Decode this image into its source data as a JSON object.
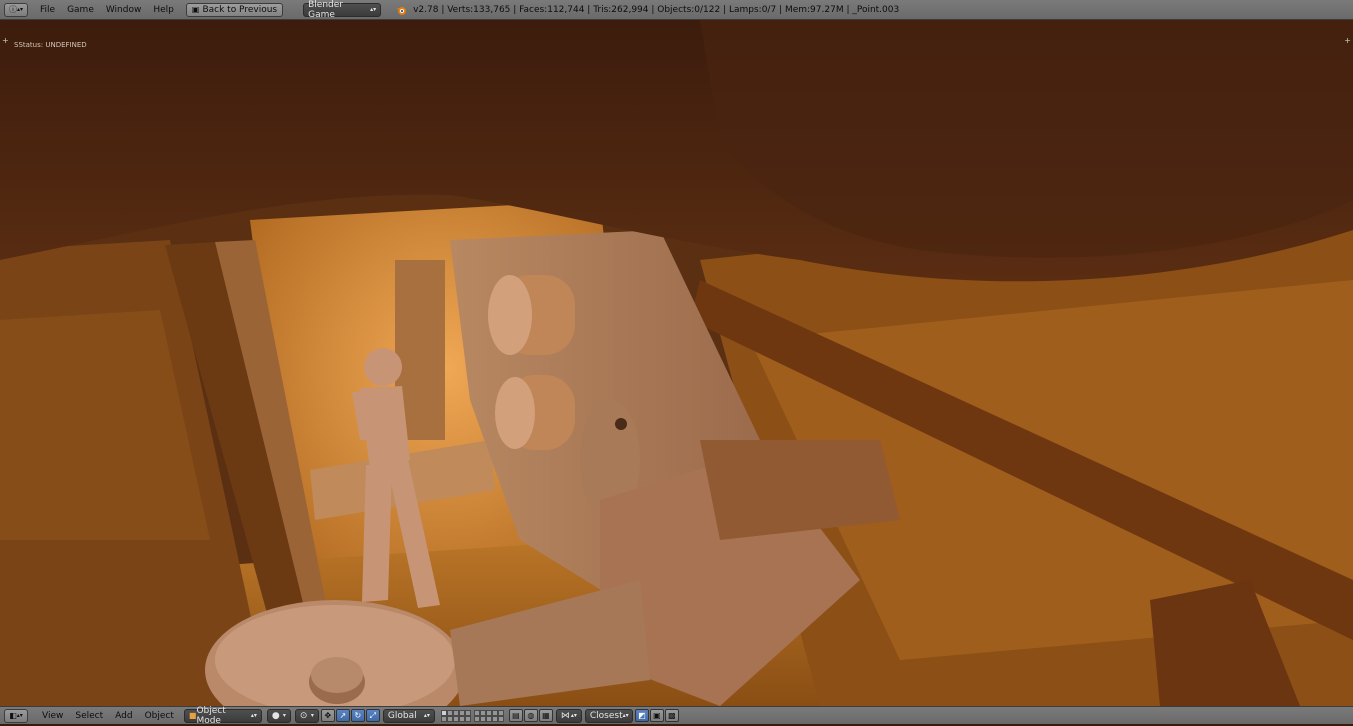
{
  "top_header": {
    "menus": [
      "File",
      "Game",
      "Window",
      "Help"
    ],
    "back_button_label": "Back to Previous",
    "engine_select": "Blender Game",
    "scene_stats": "v2.78 | Verts:133,765 | Faces:112,744 | Tris:262,994 | Objects:0/122 | Lamps:0/7 | Mem:97.27M | _Point.003"
  },
  "viewport": {
    "status_text": "SStatus: UNDEFINED"
  },
  "bottom_header": {
    "menus": [
      "View",
      "Select",
      "Add",
      "Object"
    ],
    "mode_select": "Object Mode",
    "orientation_select": "Global",
    "snap_select": "Closest"
  },
  "colors": {
    "header_bg": "#727272",
    "scene_dark": "#3a1c0c",
    "scene_amber": "#b8741f",
    "manipulator_active": "#4a75b4"
  },
  "icons": {
    "editor_type": "info-icon",
    "blender_logo": "blender-logo-icon",
    "viewport_editor": "3d-view-icon"
  }
}
